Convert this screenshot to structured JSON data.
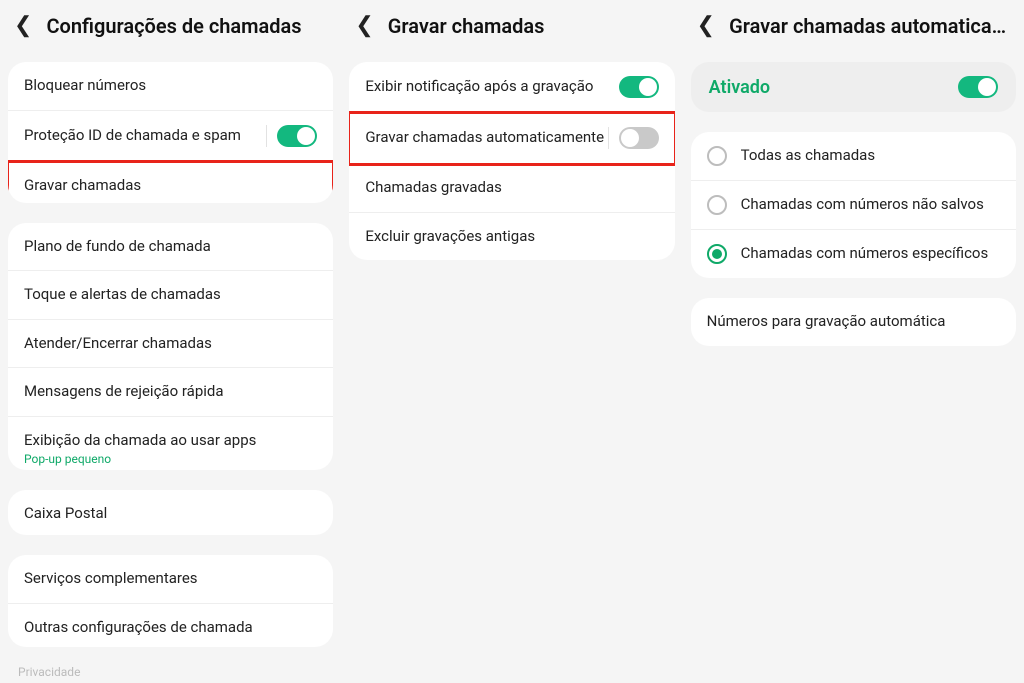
{
  "panel1": {
    "title": "Configurações de chamadas",
    "group1": {
      "block_numbers": "Bloquear números",
      "caller_id_spam": "Proteção ID de chamada e spam",
      "record_calls": "Gravar chamadas"
    },
    "group2": {
      "call_background": "Plano de fundo de chamada",
      "ringtone_alerts": "Toque e alertas de chamadas",
      "answer_end": "Atender/Encerrar chamadas",
      "quick_decline": "Mensagens de rejeição rápida",
      "call_display": "Exibição da chamada ao usar apps",
      "call_display_sub": "Pop-up pequeno"
    },
    "group3": {
      "voicemail": "Caixa Postal"
    },
    "group4": {
      "supplementary": "Serviços complementares",
      "other_settings": "Outras configurações de chamada"
    },
    "footer": "Privacidade"
  },
  "panel2": {
    "title": "Gravar chamadas",
    "group1": {
      "show_notification": "Exibir notificação após a gravação",
      "auto_record": "Gravar chamadas automaticamente",
      "recorded_calls": "Chamadas gravadas",
      "delete_old": "Excluir gravações antigas"
    }
  },
  "panel3": {
    "title": "Gravar chamadas automatica…",
    "activated": "Ativado",
    "options": {
      "all_calls": "Todas as chamadas",
      "unsaved": "Chamadas com números não salvos",
      "specific": "Chamadas com números específicos"
    },
    "group2": {
      "numbers_for_auto": "Números para gravação automática"
    }
  },
  "toggles": {
    "caller_id_spam": true,
    "show_notification": true,
    "auto_record": false,
    "activated": true
  },
  "radios": {
    "selected": "specific"
  }
}
